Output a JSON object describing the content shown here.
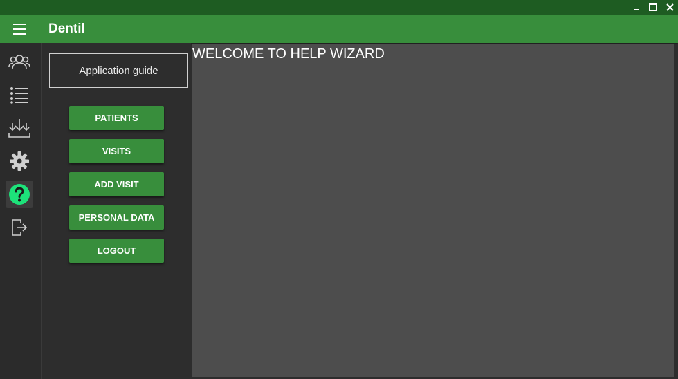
{
  "window": {
    "controls": [
      "minimize-icon",
      "maximize-icon",
      "close-icon"
    ]
  },
  "appbar": {
    "title": "Dentil",
    "menu_icon": "hamburger-menu-icon"
  },
  "nav_rail": {
    "items": [
      {
        "name": "patients",
        "icon": "people-icon",
        "active": false
      },
      {
        "name": "visits",
        "icon": "list-icon",
        "active": false
      },
      {
        "name": "import",
        "icon": "download-icon",
        "active": false
      },
      {
        "name": "settings",
        "icon": "gear-icon",
        "active": false
      },
      {
        "name": "help",
        "icon": "help-icon",
        "active": true
      },
      {
        "name": "logout",
        "icon": "logout-icon",
        "active": false
      }
    ]
  },
  "guide": {
    "title": "Application guide",
    "buttons": [
      "PATIENTS",
      "VISITS",
      "ADD VISIT",
      "PERSONAL DATA",
      "LOGOUT"
    ]
  },
  "content": {
    "heading": "WELCOME TO HELP WIZARD"
  },
  "colors": {
    "titlebar": "#1e5c22",
    "appbar": "#388e3c",
    "accent_help": "#1de27a",
    "background": "#2d2d2d",
    "content_bg": "#4d4d4d"
  }
}
